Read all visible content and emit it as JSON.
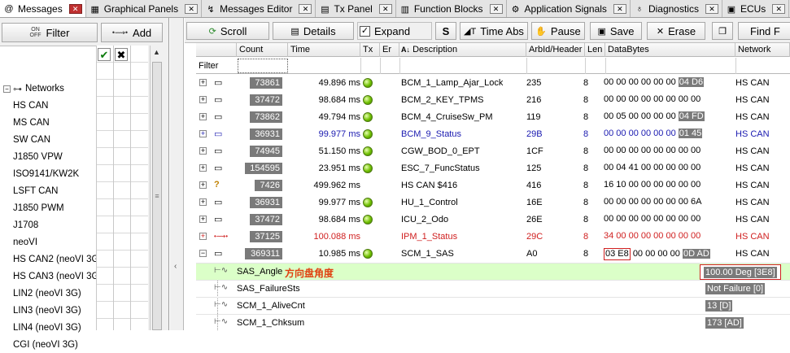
{
  "tabs": [
    {
      "label": "Messages",
      "icon": "at-icon",
      "glyph": "@",
      "active": true
    },
    {
      "label": "Graphical Panels",
      "icon": "panel-icon",
      "glyph": "▦"
    },
    {
      "label": "Messages Editor",
      "icon": "message-editor-icon",
      "glyph": "↯"
    },
    {
      "label": "Tx Panel",
      "icon": "tx-panel-icon",
      "glyph": "▤"
    },
    {
      "label": "Function Blocks",
      "icon": "function-blocks-icon",
      "glyph": "▥"
    },
    {
      "label": "Application Signals",
      "icon": "app-signals-icon",
      "glyph": "⚙"
    },
    {
      "label": "Diagnostics",
      "icon": "diagnostics-icon",
      "glyph": "♁"
    },
    {
      "label": "ECUs",
      "icon": "ecu-icon",
      "glyph": "▣"
    }
  ],
  "tab_close_glyph": "✕",
  "left_panel": {
    "filter_label": "Filter",
    "filter_icon_text": "ON\nOFF",
    "add_label": "Add",
    "add_icon_text": "•⟿•",
    "tree_root": "Networks",
    "networks": [
      "HS CAN",
      "MS CAN",
      "SW CAN",
      "J1850 VPW",
      "ISO9141/KW2K",
      "LSFT CAN",
      "J1850 PWM",
      "J1708",
      "neoVI",
      "HS CAN2 (neoVI 3G)",
      "HS CAN3 (neoVI 3G)",
      "LIN2 (neoVI 3G)",
      "LIN3 (neoVI 3G)",
      "LIN4 (neoVI 3G)",
      "CGI (neoVI 3G)"
    ]
  },
  "toolbar": {
    "scroll": "Scroll",
    "details": "Details",
    "expand": "Expand",
    "expand_checked": true,
    "s_button": "S",
    "time_abs": "Time Abs",
    "pause": "Pause",
    "save": "Save",
    "erase": "Erase",
    "find": "Find F"
  },
  "columns": {
    "count": "Count",
    "time": "Time",
    "tx": "Tx",
    "er": "Er",
    "description": "Description",
    "arbid": "ArbId/Header",
    "len": "Len",
    "databytes": "DataBytes",
    "network": "Network"
  },
  "filter_label": "Filter",
  "messages": [
    {
      "count": "73861",
      "time": "49.896 ms",
      "desc": "BCM_1_Lamp_Ajar_Lock",
      "arbid": "235",
      "len": "8",
      "data": "00 00 00 00 00 00",
      "data_hl": "04 D6",
      "network": "HS CAN",
      "style": ""
    },
    {
      "count": "37472",
      "time": "98.684 ms",
      "desc": "BCM_2_KEY_TPMS",
      "arbid": "216",
      "len": "8",
      "data": "00 00 00 00 00 00 00 00",
      "data_hl": "",
      "network": "HS CAN",
      "style": ""
    },
    {
      "count": "73862",
      "time": "49.794 ms",
      "desc": "BCM_4_CruiseSw_PM",
      "arbid": "119",
      "len": "8",
      "data": "00 05 00 00 00 00",
      "data_hl": "04 FD",
      "network": "HS CAN",
      "style": ""
    },
    {
      "count": "36931",
      "time": "99.977 ms",
      "desc": "BCM_9_Status",
      "arbid": "29B",
      "len": "8",
      "data": "00 00 00 00 00 00",
      "data_hl": "01 45",
      "network": "HS CAN",
      "style": "blue"
    },
    {
      "count": "74945",
      "time": "51.150 ms",
      "desc": "CGW_BOD_0_EPT",
      "arbid": "1CF",
      "len": "8",
      "data": "00 00 00 00 00 00 00 00",
      "data_hl": "",
      "network": "HS CAN",
      "style": ""
    },
    {
      "count": "154595",
      "time": "23.951 ms",
      "desc": "ESC_7_FuncStatus",
      "arbid": "125",
      "len": "8",
      "data": "00 04 41 00 00 00 00 00",
      "data_hl": "",
      "network": "HS CAN",
      "style": ""
    },
    {
      "count": "7426",
      "time": "499.962 ms",
      "desc": "HS CAN $416",
      "arbid": "416",
      "len": "8",
      "data": "16 10 00 00 00 00 00 00",
      "data_hl": "",
      "network": "HS CAN",
      "style": "",
      "unknown": true
    },
    {
      "count": "36931",
      "time": "99.977 ms",
      "desc": "HU_1_Control",
      "arbid": "16E",
      "len": "8",
      "data": "00 00 00 00 00 00 00 6A",
      "data_hl": "",
      "network": "HS CAN",
      "style": ""
    },
    {
      "count": "37472",
      "time": "98.684 ms",
      "desc": "ICU_2_Odo",
      "arbid": "26E",
      "len": "8",
      "data": "00 00 00 00 00 00 00 00",
      "data_hl": "",
      "network": "HS CAN",
      "style": ""
    },
    {
      "count": "37125",
      "time": "100.088 ms",
      "desc": "IPM_1_Status",
      "arbid": "29C",
      "len": "8",
      "data": "34 00 00 00 00 00 00 00",
      "data_hl": "",
      "network": "HS CAN",
      "style": "red",
      "tx": true
    },
    {
      "count": "369311",
      "time": "10.985 ms",
      "desc": "SCM_1_SAS",
      "arbid": "A0",
      "len": "8",
      "data_box": "03 E8",
      "data": "00 00 00 00",
      "data_hl": "0D AD",
      "network": "HS CAN",
      "style": "",
      "expanded": true
    }
  ],
  "signals": [
    {
      "name": "SAS_Angle",
      "annotation": "方向盘角度",
      "value_main": "100.00 Deg",
      "value_raw": "[3E8]",
      "highlight": true
    },
    {
      "name": "SAS_FailureSts",
      "value_main": "Not Failure",
      "value_raw": "[0]"
    },
    {
      "name": "SCM_1_AliveCnt",
      "value_main": "13",
      "value_raw": "[D]"
    },
    {
      "name": "SCM_1_Chksum",
      "value_main": "173",
      "value_raw": "[AD]"
    }
  ],
  "colors": {
    "row_blue": "#1a1ab0",
    "row_red": "#d02020",
    "signal_highlight": "#dbffc8",
    "annotation": "#e04010",
    "count_bg": "#7a7a7a"
  }
}
